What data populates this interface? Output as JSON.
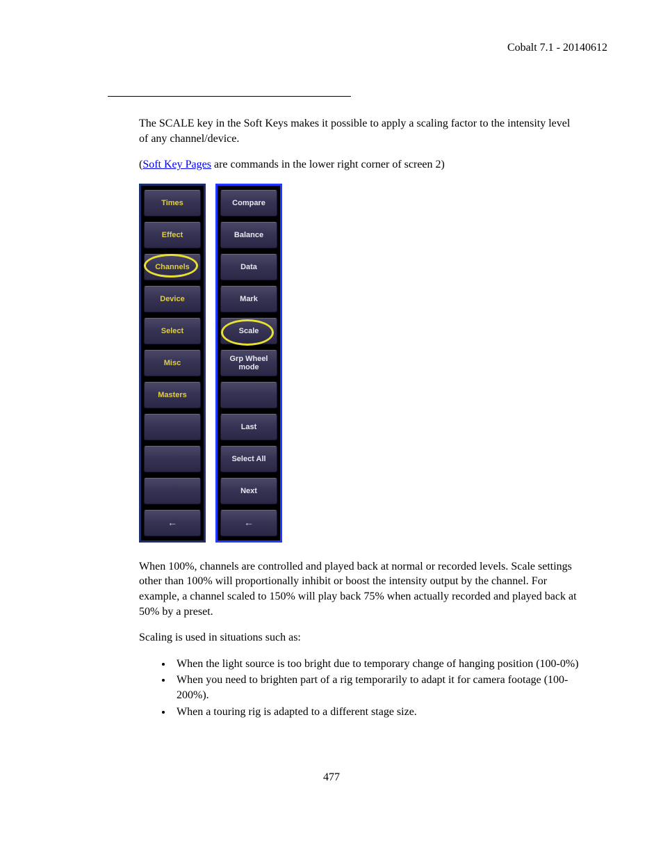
{
  "header": {
    "version": "Cobalt 7.1 - 20140612"
  },
  "intro": {
    "p1": "The SCALE key in the Soft Keys makes it possible to apply a scaling factor to the intensity level of any channel/device.",
    "p2_open": "(",
    "p2_link": "Soft Key Pages",
    "p2_rest": " are commands in the lower right corner of screen 2)"
  },
  "softkeys": {
    "left": [
      "Times",
      "Effect",
      "Channels",
      "Device",
      "Select",
      "Misc",
      "Masters",
      "",
      "",
      "",
      "←"
    ],
    "right": [
      "Compare",
      "Balance",
      "Data",
      "Mark",
      "Scale",
      "Grp Wheel mode",
      "",
      "Last",
      "Select All",
      "Next",
      "←"
    ]
  },
  "body": {
    "p3": "When 100%, channels are controlled and played back at normal or recorded levels. Scale settings other than 100% will proportionally inhibit or boost the intensity output by the channel. For example, a channel scaled to 150% will play back 75% when actually recorded and played back at 50% by a preset.",
    "p4": "Scaling is used in situations such as:",
    "bullets": [
      "When the light source is too bright due to temporary change of hanging position (100-0%)",
      "When you need to brighten part of a rig temporarily to adapt it for camera footage (100-200%).",
      "When a touring rig is adapted to a different stage size."
    ]
  },
  "page_number": "477"
}
